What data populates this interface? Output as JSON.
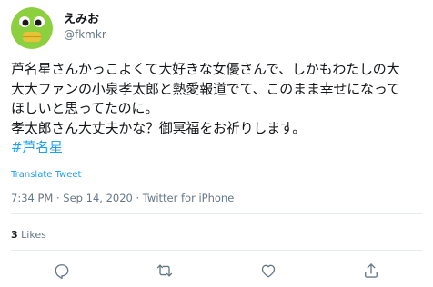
{
  "user": {
    "display_name": "えみお",
    "handle": "@fkmkr",
    "avatar_icon": "green-face-avatar-icon"
  },
  "tweet": {
    "lines": [
      "芦名星さんかっこよくて大好きな女優さんで、しかもわたしの大",
      "大大ファンの小泉孝太郎と熱愛報道でて、このまま幸せになって",
      "ほしいと思ってたのに。",
      "孝太郎さん大丈夫かな？御冥福をお祈りします。"
    ],
    "hashtag": "#芦名星",
    "translate_label": "Translate Tweet",
    "meta": "7:34 PM · Sep 14, 2020 · Twitter for iPhone"
  },
  "stats": {
    "likes_count": "3",
    "likes_label": "Likes"
  },
  "actions": {
    "reply_icon": "reply-icon",
    "retweet_icon": "retweet-icon",
    "like_icon": "heart-icon",
    "share_icon": "share-icon"
  },
  "colors": {
    "link": "#1da1f2",
    "secondary_text": "#657786",
    "primary_text": "#14171a",
    "divider": "#e6ecf0",
    "avatar_green": "#8cd03f",
    "avatar_lips": "#e8c33a"
  }
}
